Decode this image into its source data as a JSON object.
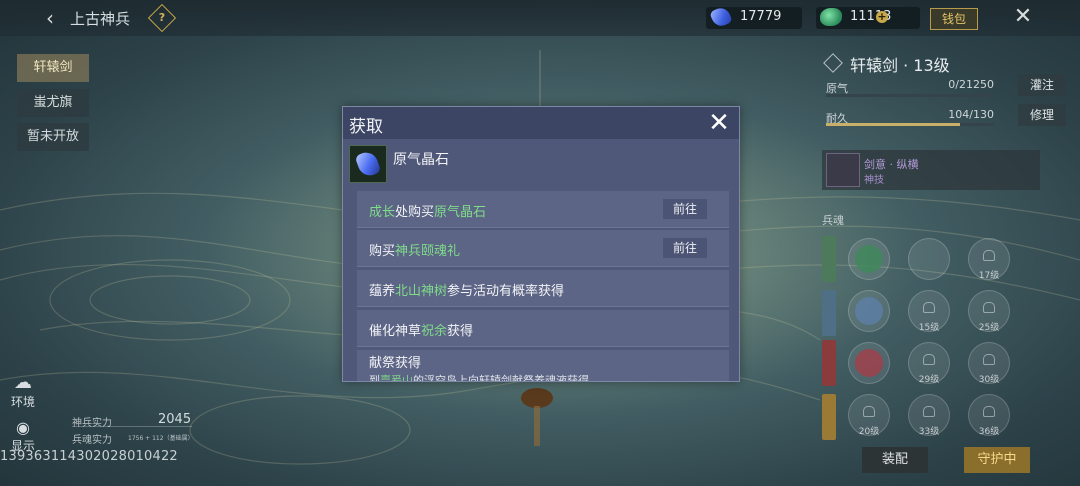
{
  "header": {
    "title": "上古神兵",
    "help_label": "?",
    "currency_blue": "17779",
    "currency_green": "11113",
    "recharge_label": "钱包"
  },
  "sidebar": {
    "items": [
      {
        "label": "轩辕剑",
        "active": true
      },
      {
        "label": "蚩尤旗",
        "active": false
      },
      {
        "label": "暂未开放",
        "active": false
      }
    ]
  },
  "weapon": {
    "name": "轩辕剑 · 13级",
    "stats": [
      {
        "label": "原气",
        "value": "0/21250",
        "progress": 0,
        "button": "灌注"
      },
      {
        "label": "耐久",
        "value": "104/130",
        "progress": 0.8,
        "button": "修理"
      }
    ],
    "skill_name": "剑意 · 纵横",
    "skill_sub": "神技",
    "soul_label": "兵魂",
    "slot_levels": [
      [
        "",
        "",
        "17级"
      ],
      [
        "",
        "15级",
        "25级"
      ],
      [
        "",
        "29级",
        "30级"
      ],
      [
        "20级",
        "33级",
        "36级"
      ]
    ],
    "equip_label": "装配",
    "guard_label": "守护中"
  },
  "left_bottom": {
    "env_label": "环境",
    "show_label": "显示",
    "power_label": "神兵实力",
    "power_value": "2045",
    "soul_power_label": "兵魂实力",
    "soul_power_value": "1756 + 112（基础属）",
    "uid": "13936311430202801042​2"
  },
  "modal": {
    "title": "获取",
    "item_name": "原气晶石",
    "rows": [
      {
        "pre": "",
        "hl": "成长",
        "mid": "处购买",
        "hl2": "原气晶石",
        "post": "",
        "go": "前往"
      },
      {
        "pre": "购买",
        "hl": "神兵颐魂礼",
        "mid": "",
        "hl2": "",
        "post": "",
        "go": "前往"
      },
      {
        "pre": "蕴养",
        "hl": "北山神树",
        "mid": "参与活动有概率获得",
        "hl2": "",
        "post": "",
        "go": ""
      },
      {
        "pre": "催化神草",
        "hl": "祝余",
        "mid": "获得",
        "hl2": "",
        "post": "",
        "go": ""
      },
      {
        "pre": "献祭获得",
        "hl": "",
        "mid": "",
        "hl2": "",
        "post": "",
        "go": "",
        "sub_pre": "到",
        "sub_hl": "亶爰山",
        "sub_post": "的浮空岛上向轩辕剑献祭养魂液获得"
      }
    ]
  },
  "colors": {
    "highlight_green": "#7fdc8a",
    "gold": "#c9a84a",
    "modal_bg": "#50587a"
  }
}
